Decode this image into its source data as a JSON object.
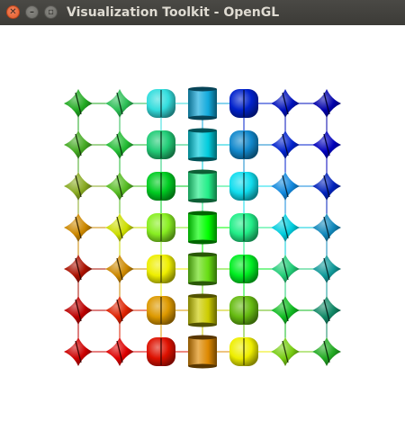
{
  "window": {
    "title": "Visualization Toolkit - OpenGL",
    "close_icon": "close-icon",
    "minimize_icon": "minimize-icon",
    "maximize_icon": "maximize-icon"
  },
  "scene": {
    "background": "#ffffff",
    "rows": 7,
    "cols": 7,
    "glyph_grid": [
      [
        {
          "shape": "diamond",
          "color": "#22aa22"
        },
        {
          "shape": "diamond",
          "color": "#2bbe55"
        },
        {
          "shape": "round",
          "color": "#33dddd"
        },
        {
          "shape": "cylinder",
          "color": "#11aadd"
        },
        {
          "shape": "round",
          "color": "#0022cc"
        },
        {
          "shape": "diamond",
          "color": "#0011bb"
        },
        {
          "shape": "diamond",
          "color": "#0000aa"
        }
      ],
      [
        {
          "shape": "diamond",
          "color": "#44aa22"
        },
        {
          "shape": "diamond",
          "color": "#22bb33"
        },
        {
          "shape": "round",
          "color": "#22cc77"
        },
        {
          "shape": "cylinder",
          "color": "#00ccdd"
        },
        {
          "shape": "round",
          "color": "#1188cc"
        },
        {
          "shape": "diamond",
          "color": "#0022cc"
        },
        {
          "shape": "diamond",
          "color": "#0000bb"
        }
      ],
      [
        {
          "shape": "diamond",
          "color": "#88aa22"
        },
        {
          "shape": "diamond",
          "color": "#55bb22"
        },
        {
          "shape": "round",
          "color": "#00cc22"
        },
        {
          "shape": "cylinder",
          "color": "#22ee88"
        },
        {
          "shape": "round",
          "color": "#11ddee"
        },
        {
          "shape": "diamond",
          "color": "#1188dd"
        },
        {
          "shape": "diamond",
          "color": "#0022bb"
        }
      ],
      [
        {
          "shape": "diamond",
          "color": "#cc8800"
        },
        {
          "shape": "diamond",
          "color": "#ccdd00"
        },
        {
          "shape": "round",
          "color": "#88ee22"
        },
        {
          "shape": "cylinder",
          "color": "#00ff00"
        },
        {
          "shape": "round",
          "color": "#22ee88"
        },
        {
          "shape": "diamond",
          "color": "#00ccdd"
        },
        {
          "shape": "diamond",
          "color": "#1188bb"
        }
      ],
      [
        {
          "shape": "diamond",
          "color": "#aa1100"
        },
        {
          "shape": "diamond",
          "color": "#cc8800"
        },
        {
          "shape": "round",
          "color": "#eeee00"
        },
        {
          "shape": "cylinder",
          "color": "#66dd11"
        },
        {
          "shape": "round",
          "color": "#00ee22"
        },
        {
          "shape": "diamond",
          "color": "#22cc77"
        },
        {
          "shape": "diamond",
          "color": "#119999"
        }
      ],
      [
        {
          "shape": "diamond",
          "color": "#bb0000"
        },
        {
          "shape": "diamond",
          "color": "#dd2200"
        },
        {
          "shape": "round",
          "color": "#dd9900"
        },
        {
          "shape": "cylinder",
          "color": "#cccc00"
        },
        {
          "shape": "round",
          "color": "#66bb11"
        },
        {
          "shape": "diamond",
          "color": "#11bb22"
        },
        {
          "shape": "diamond",
          "color": "#118866"
        }
      ],
      [
        {
          "shape": "diamond",
          "color": "#cc0000"
        },
        {
          "shape": "diamond",
          "color": "#dd0000"
        },
        {
          "shape": "round",
          "color": "#dd1100"
        },
        {
          "shape": "cylinder",
          "color": "#dd8800"
        },
        {
          "shape": "round",
          "color": "#eeee00"
        },
        {
          "shape": "diamond",
          "color": "#77cc11"
        },
        {
          "shape": "diamond",
          "color": "#22aa22"
        }
      ]
    ]
  }
}
